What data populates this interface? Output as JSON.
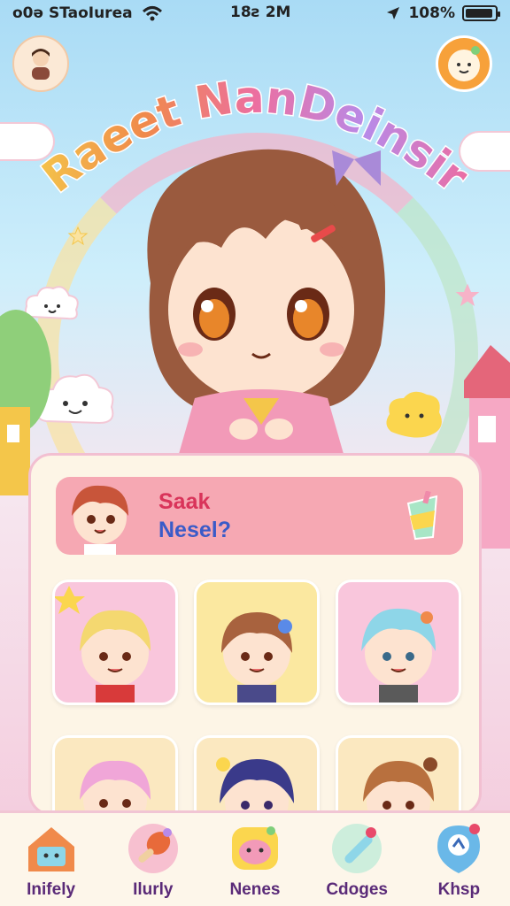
{
  "status_bar": {
    "left": "o0ə STaoIurea",
    "time": "18ƨ 2M",
    "battery": "108%"
  },
  "title": {
    "text": "Raeet NanDeinsir"
  },
  "chat": {
    "line1": "Saak",
    "line2": "Nesel?"
  },
  "nav": {
    "items": [
      {
        "label": "Inifely"
      },
      {
        "label": "Ilurly"
      },
      {
        "label": "Nenes"
      },
      {
        "label": "Cdoges"
      },
      {
        "label": "Khsp"
      }
    ]
  },
  "colors": {
    "accent_pink": "#f6a8b3",
    "nav_label": "#5a2a78",
    "panel_border": "#f2bfd1"
  }
}
